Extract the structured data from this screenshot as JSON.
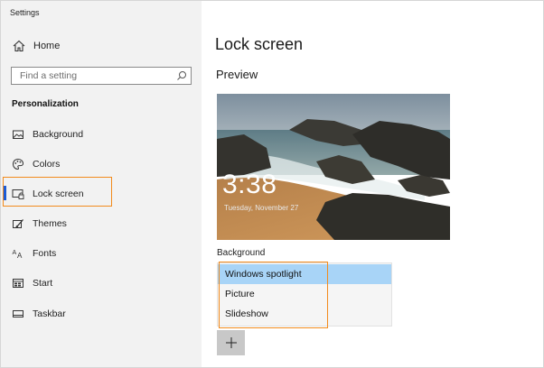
{
  "app": {
    "title": "Settings"
  },
  "sidebar": {
    "home_label": "Home",
    "search_placeholder": "Find a setting",
    "section": "Personalization",
    "items": [
      {
        "label": "Background",
        "icon": "image-icon"
      },
      {
        "label": "Colors",
        "icon": "palette-icon"
      },
      {
        "label": "Lock screen",
        "icon": "lock-screen-icon",
        "active": true
      },
      {
        "label": "Themes",
        "icon": "themes-icon"
      },
      {
        "label": "Fonts",
        "icon": "fonts-icon"
      },
      {
        "label": "Start",
        "icon": "start-icon"
      },
      {
        "label": "Taskbar",
        "icon": "taskbar-icon"
      }
    ]
  },
  "main": {
    "title": "Lock screen",
    "preview_label": "Preview",
    "preview_time": "3:38",
    "preview_date": "Tuesday, November 27",
    "background_label": "Background",
    "background_options": [
      "Windows spotlight",
      "Picture",
      "Slideshow"
    ],
    "background_selected": "Windows spotlight",
    "add_button": "+"
  },
  "colors": {
    "accent": "#1c5bd5",
    "highlight_box": "#f28b1d",
    "selected_option": "#a8d4f7",
    "sidebar_bg": "#f2f2f2"
  }
}
